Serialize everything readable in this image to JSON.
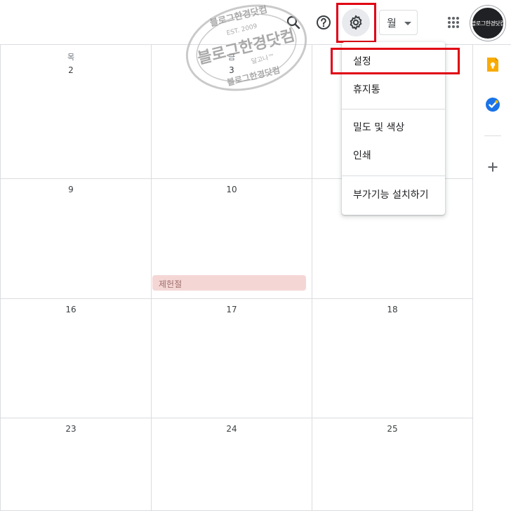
{
  "toolbar": {
    "search_icon": "search-icon",
    "help_icon": "help-icon",
    "settings_icon": "gear-icon",
    "view_selector_value": "월",
    "apps_icon": "apps-grid-icon",
    "account_label": "블로그한경닷컴"
  },
  "watermark": {
    "top_text": "블로그한경닷컴",
    "est": "EST. 2009",
    "main_text": "블로그한경닷컴",
    "tagline": "달고나™",
    "bottom_text": "블로그한경닷컴"
  },
  "calendar": {
    "weekday_headers": [
      "목",
      "금"
    ],
    "weeks": [
      [
        "2",
        "3",
        ""
      ],
      [
        "9",
        "10",
        ""
      ],
      [
        "16",
        "17",
        "18"
      ],
      [
        "23",
        "24",
        "25"
      ]
    ],
    "events": [
      {
        "title": "제헌절",
        "color": "#f4d7d5"
      }
    ]
  },
  "settings_menu": {
    "items": [
      "설정",
      "휴지통",
      "밀도 및 색상",
      "인쇄",
      "부가기능 설치하기"
    ]
  },
  "side_panel": {
    "icons": [
      "keep-icon",
      "tasks-icon",
      "add-icon"
    ]
  },
  "colors": {
    "highlight": "#e00012",
    "grid_line": "#dadce0",
    "keep": "#f9ab00",
    "tasks": "#1a73e8"
  }
}
